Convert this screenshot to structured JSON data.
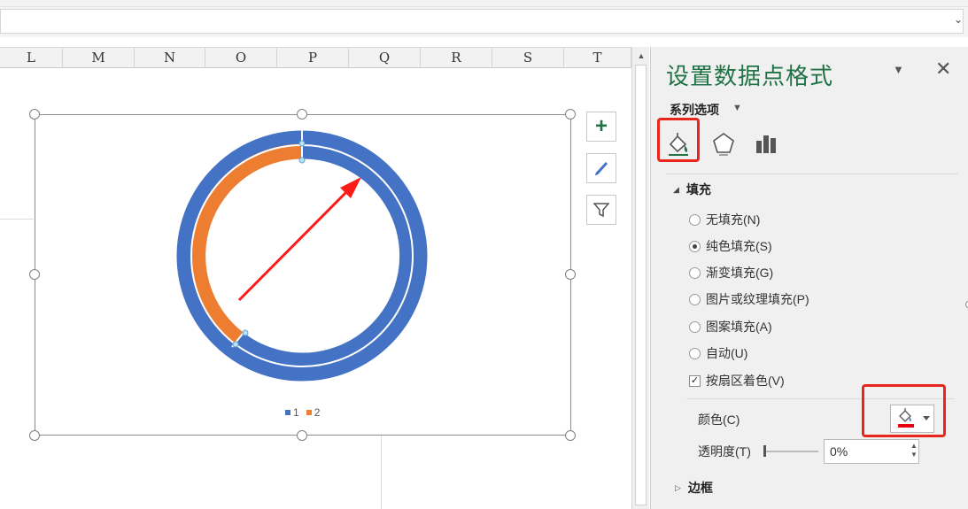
{
  "spreadsheet": {
    "columns": [
      "L",
      "M",
      "N",
      "O",
      "P",
      "Q",
      "R",
      "S",
      "T"
    ]
  },
  "chart": {
    "type": "doughnut",
    "legend": [
      {
        "label": "1",
        "color": "#4472c4"
      },
      {
        "label": "2",
        "color": "#ed7d31"
      }
    ],
    "annotation_color": "#ff0000"
  },
  "chart_tools": {
    "add_elements_icon": "plus-icon",
    "styles_icon": "brush-icon",
    "filter_icon": "filter-icon"
  },
  "format_pane": {
    "title": "设置数据点格式",
    "series_options_label": "系列选项",
    "tabs": [
      "fill-line-icon",
      "effects-icon",
      "series-options-icon"
    ],
    "fill_section": {
      "header": "填充",
      "options": [
        {
          "label": "无填充(N)",
          "checked": false
        },
        {
          "label": "纯色填充(S)",
          "checked": true
        },
        {
          "label": "渐变填充(G)",
          "checked": false
        },
        {
          "label": "图片或纹理填充(P)",
          "checked": false
        },
        {
          "label": "图案填充(A)",
          "checked": false
        },
        {
          "label": "自动(U)",
          "checked": false
        }
      ],
      "vary_colors_label": "按扇区着色(V)",
      "vary_colors_checked": true,
      "color_label": "颜色(C)",
      "transparency_label": "透明度(T)",
      "transparency_value": "0%"
    },
    "border_section": {
      "header": "边框"
    },
    "accent_color": "#217346",
    "highlight_color": "#e8261c"
  }
}
